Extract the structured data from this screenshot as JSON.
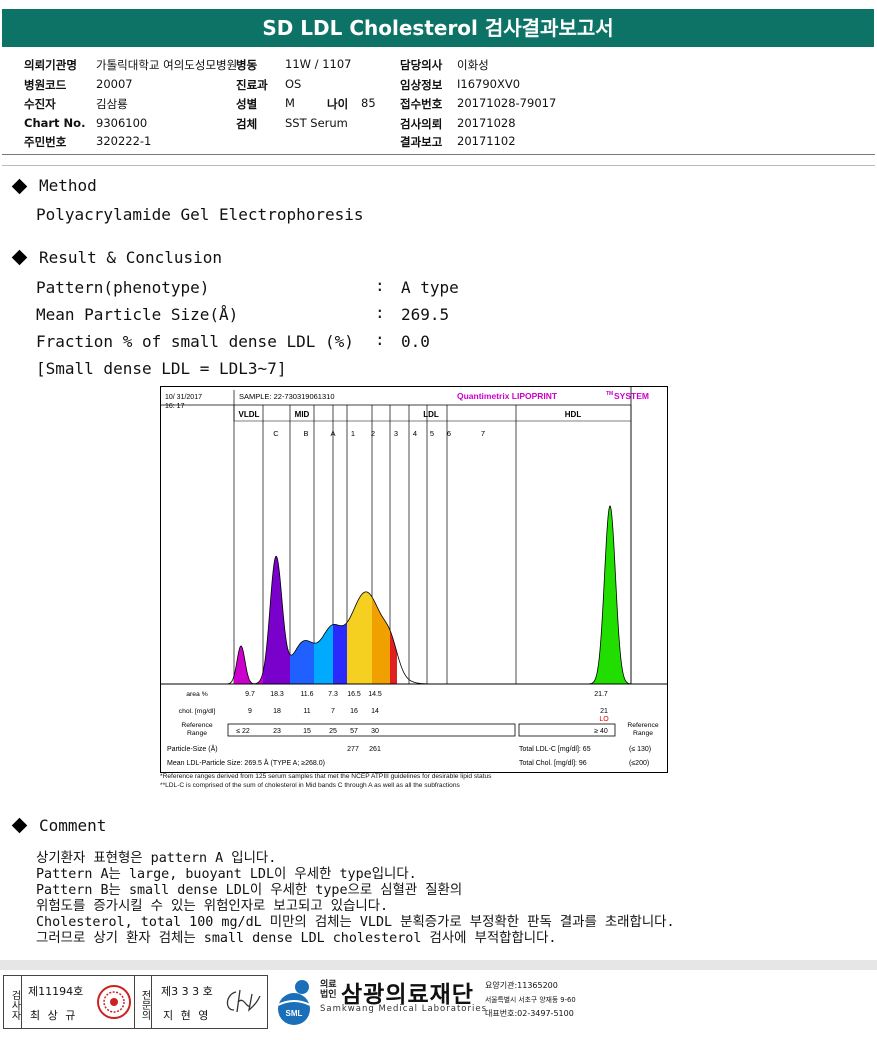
{
  "title": "SD LDL Cholesterol 검사결과보고서",
  "header": {
    "col1": [
      {
        "label": "의뢰기관명",
        "value": "가톨릭대학교 여의도성모병원"
      },
      {
        "label": "병원코드",
        "value": "20007"
      },
      {
        "label": "수진자",
        "value": "김삼룡"
      },
      {
        "label": "Chart No.",
        "value": "9306100"
      },
      {
        "label": "주민번호",
        "value": "320222-1"
      }
    ],
    "col2": [
      {
        "label": "병동",
        "value": "11W / 1107"
      },
      {
        "label": "진료과",
        "value": "OS"
      },
      {
        "label": "성별",
        "value": "M"
      },
      {
        "label": "검체",
        "value": "SST Serum"
      }
    ],
    "age": {
      "label": "나이",
      "value": "85"
    },
    "col3": [
      {
        "label": "담당의사",
        "value": "이화성"
      },
      {
        "label": "임상정보",
        "value": "I16790XV0"
      },
      {
        "label": "접수번호",
        "value": "20171028-79017"
      },
      {
        "label": "검사의뢰",
        "value": "20171028"
      },
      {
        "label": "결과보고",
        "value": "20171102"
      }
    ]
  },
  "method": {
    "heading": "Method",
    "text": "Polyacrylamide Gel Electrophoresis"
  },
  "result": {
    "heading": "Result & Conclusion",
    "rows": [
      {
        "label": "Pattern(phenotype)",
        "value": "A type"
      },
      {
        "label": "Mean Particle Size(Å)",
        "value": "269.5"
      },
      {
        "label": "Fraction % of small dense LDL (%)",
        "value": "0.0"
      }
    ],
    "colon": ":",
    "note": "[Small dense LDL = LDL3~7]"
  },
  "chart_data": {
    "type": "area",
    "date": "10/ 31/2017",
    "time": "16: 17",
    "sample": "SAMPLE:  22-730319061310",
    "brand": "Quantimetrix LIPOPRINT",
    "brand_tm": "TM",
    "brand_tail": "SYSTEM",
    "regions": [
      "VLDL",
      "MID",
      "LDL",
      "HDL"
    ],
    "bands": [
      "C",
      "B",
      "A",
      "1",
      "2",
      "3",
      "4",
      "5",
      "6",
      "7"
    ],
    "band_colors": {
      "VLDL": "#cc00cc",
      "C": "#7a00cc",
      "B": "#2060ff",
      "A": "#00aaff",
      "1": "#2a2aff",
      "2": "#f5d020",
      "3": "#f0a000",
      "HDL": "#22dd00"
    },
    "row_labels": {
      "area": "area %",
      "chol": "chol. [mg/dl]",
      "ref": "Reference Range",
      "ref_right": "Reference Range",
      "size": "Particle-Size (Å)",
      "mean": "Mean LDL-Particle Size:   269.5 Å  (TYPE A; ≥268.0)"
    },
    "area": [
      "9.7",
      "18.3",
      "11.6",
      "7.3",
      "16.5",
      "14.5",
      "21.7"
    ],
    "chol": [
      "9",
      "18",
      "11",
      "7",
      "16",
      "14",
      "21"
    ],
    "hdl_flag": "LO",
    "ref": [
      "≤ 22",
      "23",
      "15",
      "25",
      "57",
      "30"
    ],
    "ref_hdl": "≥ 40",
    "size": [
      "277",
      "261"
    ],
    "total_ldl": "Total LDL-C [mg/dl]:  65",
    "total_ldl_ref": "(≤ 130)",
    "total_chol": "Total Chol. [mg/dl]:    96",
    "total_chol_ref": "(≤200)",
    "footnote1": "*Reference ranges derived from 125 serum samples that met the NCEP ATPIII guidelines for desirable lipid status",
    "footnote2": "**LDL-C is comprised of the sum of cholesterol in Mid bands C through A as well as all the subfractions"
  },
  "comment": {
    "heading": "Comment",
    "lines": [
      "상기환자 표현형은 pattern A 입니다.",
      "Pattern A는 large, buoyant LDL이 우세한 type입니다.",
      "Pattern B는 small dense LDL이 우세한 type으로 심혈관 질환의",
      "위험도를 증가시킬 수 있는 위험인자로 보고되고 있습니다.",
      "Cholesterol, total 100 mg/dL 미만의 검체는 VLDL 분획증가로 부정확한 판독 결과를 초래합니다.",
      "그러므로 상기 환자 검체는 small dense LDL cholesterol 검사에 부적합합니다."
    ]
  },
  "footer": {
    "tester_tag": "검사자",
    "tester_no": "제11194호",
    "tester_name": "최 상 규",
    "doctor_tag": "전문의",
    "doctor_no": "제3 3 3 호",
    "doctor_name": "지 현 영",
    "org_small": "의료법인",
    "org_name": "삼광의료재단",
    "org_en": "Samkwang Medical Laboratories",
    "logo_text": "SML",
    "info1": "요양기관:11365200",
    "info2": "서울특별시 서초구 양재동 9-60",
    "info3": "대표번호:02-3497-5100"
  }
}
